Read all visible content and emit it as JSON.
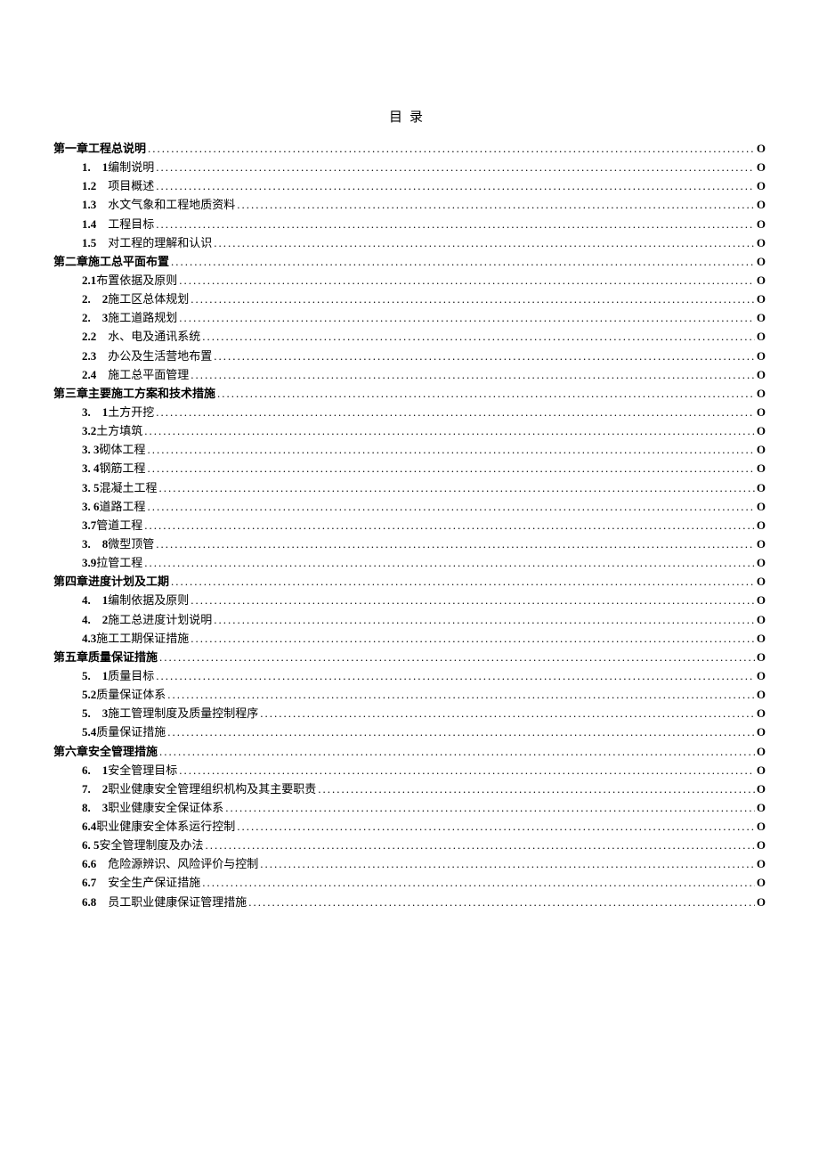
{
  "title": "目录",
  "entries": [
    {
      "level": 1,
      "num": "",
      "text": "第一章工程总说明",
      "page": "O"
    },
    {
      "level": 2,
      "num": "1.　1",
      "text": "编制说明",
      "page": "O"
    },
    {
      "level": 2,
      "num": "1.2",
      "text": "　项目概述",
      "page": "O"
    },
    {
      "level": 2,
      "num": "1.3",
      "text": "　水文气象和工程地质资料",
      "page": "O"
    },
    {
      "level": 2,
      "num": "1.4",
      "text": "　工程目标",
      "page": "O"
    },
    {
      "level": 2,
      "num": "1.5",
      "text": "　对工程的理解和认识",
      "page": "O"
    },
    {
      "level": 1,
      "num": "",
      "text": "第二章施工总平面布置",
      "page": "O"
    },
    {
      "level": 2,
      "num": "2.1",
      "text": "布置依据及原则",
      "page": "O"
    },
    {
      "level": 2,
      "num": "2.　2",
      "text": "施工区总体规划",
      "page": "O"
    },
    {
      "level": 2,
      "num": "2.　3",
      "text": "施工道路规划",
      "page": "O"
    },
    {
      "level": 2,
      "num": "2.2",
      "text": "　水、电及通讯系统",
      "page": "O"
    },
    {
      "level": 2,
      "num": "2.3",
      "text": "　办公及生活营地布置",
      "page": "O"
    },
    {
      "level": 2,
      "num": "2.4",
      "text": "　施工总平面管理",
      "page": "O"
    },
    {
      "level": 1,
      "num": "",
      "text": "第三章主要施工方案和技术措施",
      "page": "O"
    },
    {
      "level": 2,
      "num": "3.　1",
      "text": " 土方开挖",
      "page": "O"
    },
    {
      "level": 2,
      "num": "3.2",
      "text": " 土方填筑",
      "page": "O"
    },
    {
      "level": 2,
      "num": "3. 3",
      "text": "砌体工程",
      "page": "O"
    },
    {
      "level": 2,
      "num": "3. 4",
      "text": "钢筋工程",
      "page": "O"
    },
    {
      "level": 2,
      "num": "3. 5",
      "text": "混凝土工程",
      "page": "O"
    },
    {
      "level": 2,
      "num": "3. 6",
      "text": "道路工程",
      "page": "O"
    },
    {
      "level": 2,
      "num": "3.7",
      "text": "管道工程",
      "page": "O"
    },
    {
      "level": 2,
      "num": "3.　8",
      "text": "微型顶管",
      "page": "O"
    },
    {
      "level": 2,
      "num": "3.9",
      "text": "拉管工程",
      "page": "O"
    },
    {
      "level": 1,
      "num": "",
      "text": "第四章进度计划及工期",
      "page": "O"
    },
    {
      "level": 2,
      "num": "4.　1",
      "text": "编制依据及原则",
      "page": "O"
    },
    {
      "level": 2,
      "num": "4.　2",
      "text": "施工总进度计划说明",
      "page": "O"
    },
    {
      "level": 2,
      "num": "4.3",
      "text": "施工工期保证措施",
      "page": "O"
    },
    {
      "level": 1,
      "num": "",
      "text": "第五章质量保证措施",
      "page": "O"
    },
    {
      "level": 2,
      "num": "5.　1",
      "text": "质量目标",
      "page": "O"
    },
    {
      "level": 2,
      "num": "5.2",
      "text": "质量保证体系",
      "page": "O"
    },
    {
      "level": 2,
      "num": "5.　3",
      "text": "施工管理制度及质量控制程序",
      "page": "O"
    },
    {
      "level": 2,
      "num": "5.4",
      "text": "质量保证措施",
      "page": "O"
    },
    {
      "level": 1,
      "num": "",
      "text": "第六章安全管理措施",
      "page": "O"
    },
    {
      "level": 2,
      "num": "6.　1",
      "text": "安全管理目标",
      "page": "O"
    },
    {
      "level": 2,
      "num": "7.　2",
      "text": "职业健康安全管理组织机构及其主要职责",
      "page": "O"
    },
    {
      "level": 2,
      "num": "8.　3",
      "text": "职业健康安全保证体系",
      "page": "O"
    },
    {
      "level": 2,
      "num": "6.4",
      "text": "职业健康安全体系运行控制",
      "page": "O"
    },
    {
      "level": 2,
      "num": "6. 5",
      "text": "安全管理制度及办法",
      "page": "O"
    },
    {
      "level": 2,
      "num": "6.6",
      "text": "　危险源辨识、风险评价与控制",
      "page": "O"
    },
    {
      "level": 2,
      "num": "6.7",
      "text": "　安全生产保证措施",
      "page": "O"
    },
    {
      "level": 2,
      "num": "6.8",
      "text": "　员工职业健康保证管理措施",
      "page": "O"
    }
  ]
}
